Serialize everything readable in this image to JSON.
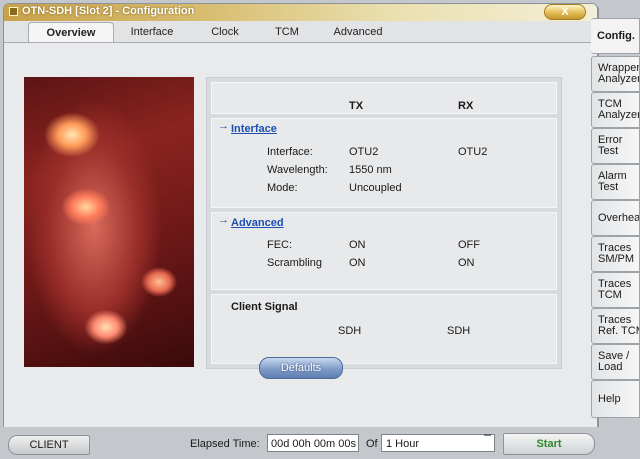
{
  "window": {
    "title": "OTN-SDH [Slot 2] - Configuration",
    "close_label": "X"
  },
  "tabs": [
    {
      "label": "Overview",
      "active": true
    },
    {
      "label": "Interface",
      "active": false
    },
    {
      "label": "Clock",
      "active": false
    },
    {
      "label": "TCM",
      "active": false
    },
    {
      "label": "Advanced",
      "active": false
    }
  ],
  "overview": {
    "col_tx": "TX",
    "col_rx": "RX",
    "interface_section": {
      "link": "Interface",
      "rows": [
        {
          "label": "Interface:",
          "tx": "OTU2",
          "rx": "OTU2"
        },
        {
          "label": "Wavelength:",
          "tx": "1550 nm",
          "rx": ""
        },
        {
          "label": "Mode:",
          "tx": "Uncoupled",
          "rx": ""
        }
      ]
    },
    "advanced_section": {
      "link": "Advanced",
      "rows": [
        {
          "label": "FEC:",
          "tx": "ON",
          "rx": "OFF"
        },
        {
          "label": "Scrambling",
          "tx": "ON",
          "rx": "ON"
        }
      ]
    },
    "client_section": {
      "title": "Client Signal",
      "tx": "SDH",
      "rx": "SDH"
    }
  },
  "defaults_label": "Defaults",
  "statusbar": {
    "client_label": "CLIENT",
    "elapsed_label": "Elapsed Time:",
    "elapsed_value": "00d 00h 00m 00s",
    "of_label": "Of",
    "duration": "1 Hour",
    "start_label": "Start"
  },
  "sidebar": [
    {
      "lines": [
        "Config."
      ],
      "active": true
    },
    {
      "lines": [
        "Wrapper",
        "Analyzer"
      ]
    },
    {
      "lines": [
        "TCM",
        "Analyzer"
      ]
    },
    {
      "lines": [
        "Error",
        "Test"
      ]
    },
    {
      "lines": [
        "Alarm",
        "Test"
      ]
    },
    {
      "lines": [
        "Overhead"
      ]
    },
    {
      "lines": [
        "Traces",
        "SM/PM"
      ]
    },
    {
      "lines": [
        "Traces",
        "TCM"
      ]
    },
    {
      "lines": [
        "Traces",
        "Ref. TCM"
      ]
    },
    {
      "lines": [
        "Save /",
        "Load"
      ]
    },
    {
      "lines": [
        "Help"
      ]
    }
  ],
  "colors": {
    "title_gold": "#c8a24a",
    "link_blue": "#1c4fb0",
    "start_green": "#2c8a2c",
    "defaults_blue": "#7f9cc8"
  }
}
